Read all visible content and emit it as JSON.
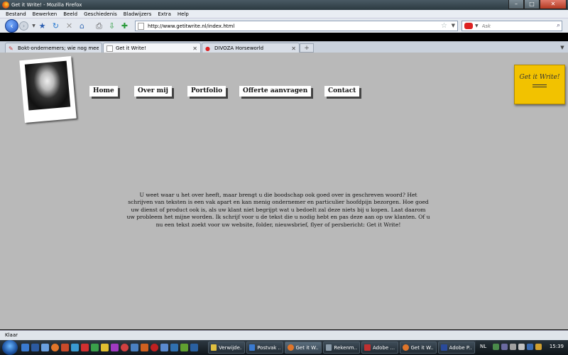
{
  "window": {
    "title": "Get it Write! - Mozilla Firefox"
  },
  "menu": [
    "Bestand",
    "Bewerken",
    "Beeld",
    "Geschiedenis",
    "Bladwijzers",
    "Extra",
    "Help"
  ],
  "navbar": {
    "url": "http://www.getitwrite.nl/index.html",
    "search_placeholder": "Ask"
  },
  "tabs": [
    {
      "label": "Bokt-ondernemers; wie nog meer? ...",
      "active": false
    },
    {
      "label": "Get it Write!",
      "active": true
    },
    {
      "label": "DIVOZA Horseworld",
      "active": false
    }
  ],
  "site": {
    "nav": [
      "Home",
      "Over mij",
      "Portfolio",
      "Offerte aanvragen",
      "Contact"
    ],
    "logo_text": "Get it Write!",
    "body": "U weet waar u het over heeft, maar brengt u die boodschap ook goed over in geschreven woord? Het schrijven van teksten is een vak apart en kan menig ondernemer en particulier hoofdpijn bezorgen. Hoe goed uw dienst of product ook is, als uw klant niet begrijpt wat u bedoelt zal deze niets bij u kopen. Laat daarom uw probleem het mijne worden. Ik schrijf voor u de tekst die u nodig hebt en pas deze aan op uw klanten. Of u nu een tekst zoekt voor uw website, folder, nieuwsbrief, flyer of persbericht: Get it Write!"
  },
  "status": "Klaar",
  "taskbar": {
    "tasks": [
      "Verwijde...",
      "Postvak ...",
      "Get it W...",
      "Rekenm...",
      "Adobe ...",
      "Get it W...",
      "Adobe P..."
    ],
    "lang": "NL",
    "clock": "15:39"
  },
  "colors": {
    "page_bg": "#b9b9b9",
    "logo_bg": "#f2c200",
    "back_button": "#1d4fbd"
  }
}
